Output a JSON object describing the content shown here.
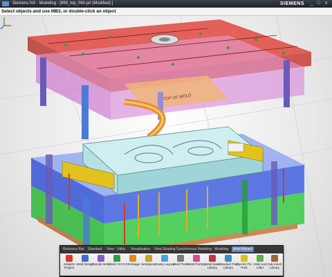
{
  "window": {
    "title": "Siemens NX - Modeling - [999_top_060.prt (Modified) ]",
    "brand": "SIEMENS",
    "minimize": "_",
    "maximize": "□",
    "close": "x"
  },
  "status": {
    "prompt": "Select objects and use MB3, or double-click an object"
  },
  "model": {
    "label": "TOP OF MOLD"
  },
  "ribbon": {
    "tabs": [
      "Resource Bar",
      "Standard",
      "View",
      "Utility",
      "Visualization",
      "View Shading",
      "Synchronous Modeling",
      "Modeling",
      "Mold Wizard"
    ],
    "active_tab": "Mold Wizard",
    "tools": [
      {
        "label": "Initialize Project",
        "icon": "initialize-project-icon",
        "color": "#d93b2c"
      },
      {
        "label": "Mold Design",
        "icon": "mold-design-icon",
        "color": "#3c6fc9"
      },
      {
        "label": "Family Mold",
        "icon": "family-mold-icon",
        "color": "#8a5cc2"
      },
      {
        "label": "Mold CSYS",
        "icon": "mold-csys-icon",
        "color": "#2e9e48"
      },
      {
        "label": "Shrinkage",
        "icon": "shrinkage-icon",
        "color": "#e08a1c"
      },
      {
        "label": "Workpiece",
        "icon": "workpiece-icon",
        "color": "#c9a227"
      },
      {
        "label": "Cavity Layout",
        "icon": "cavity-layout-icon",
        "color": "#4aa3d8"
      },
      {
        "label": "Mold Tools",
        "icon": "mold-tools-icon",
        "color": "#7a7a7a"
      },
      {
        "label": "Mold Parting",
        "icon": "mold-parting-icon",
        "color": "#d14f8f"
      },
      {
        "label": "Mold Base Library",
        "icon": "mold-base-library-icon",
        "color": "#c23a3a"
      },
      {
        "label": "Standard Part Library",
        "icon": "standard-part-library-icon",
        "color": "#3a8fc2"
      },
      {
        "label": "Ejector Pin Post",
        "icon": "ejector-pin-icon",
        "color": "#d8c21f"
      },
      {
        "label": "Slide and Lifter",
        "icon": "slide-lifter-icon",
        "color": "#5fb04a"
      },
      {
        "label": "Sub-insert Library",
        "icon": "sub-insert-library-icon",
        "color": "#9b6a3b"
      }
    ]
  },
  "colors": {
    "top_plate": "#d8322a",
    "clamp_plate": "#c15bc9",
    "lower_blue": "#2f4fd6",
    "lower_green": "#2fbf3a",
    "insert": "#bfe8ea",
    "slide": "#e2c21e",
    "runner": "#e5912a"
  }
}
